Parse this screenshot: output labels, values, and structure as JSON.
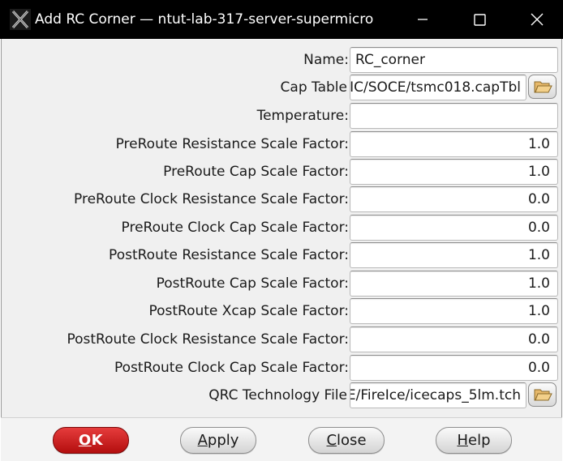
{
  "window": {
    "title": "Add RC Corner — ntut-lab-317-server-supermicro",
    "icon": "app-x-icon",
    "controls": [
      "minimize-icon",
      "maximize-icon",
      "close-icon"
    ]
  },
  "form": {
    "name": {
      "label": "Name:",
      "value": "RC_corner"
    },
    "cap_table": {
      "label": "Cap Table",
      "value": "IC/SOCE/tsmc018.capTbl"
    },
    "temperature": {
      "label": "Temperature:",
      "value": ""
    },
    "preroute_res": {
      "label": "PreRoute Resistance Scale Factor:",
      "value": "1.0"
    },
    "preroute_cap": {
      "label": "PreRoute Cap Scale Factor:",
      "value": "1.0"
    },
    "preroute_clk_res": {
      "label": "PreRoute Clock Resistance Scale Factor:",
      "value": "0.0"
    },
    "preroute_clk_cap": {
      "label": "PreRoute Clock Cap Scale Factor:",
      "value": "0.0"
    },
    "postroute_res": {
      "label": "PostRoute Resistance Scale Factor:",
      "value": "1.0"
    },
    "postroute_cap": {
      "label": "PostRoute Cap Scale Factor:",
      "value": "1.0"
    },
    "postroute_xcap": {
      "label": "PostRoute Xcap Scale Factor:",
      "value": "1.0"
    },
    "postroute_clk_res": {
      "label": "PostRoute Clock Resistance Scale Factor:",
      "value": "0.0"
    },
    "postroute_clk_cap": {
      "label": "PostRoute Clock Cap Scale Factor:",
      "value": "0.0"
    },
    "qrc_tech": {
      "label": "QRC Technology File",
      "value": "E/FireIce/icecaps_5lm.tch"
    }
  },
  "buttons": {
    "ok": {
      "first": "O",
      "rest": "K"
    },
    "apply": {
      "first": "A",
      "rest": "pply"
    },
    "close": {
      "first": "C",
      "rest": "lose"
    },
    "help": {
      "first": "H",
      "rest": "elp"
    }
  },
  "colors": {
    "titlebar": "#000000",
    "ok_button": "#c81e1e",
    "dialog_bg": "#f0f0f0"
  }
}
